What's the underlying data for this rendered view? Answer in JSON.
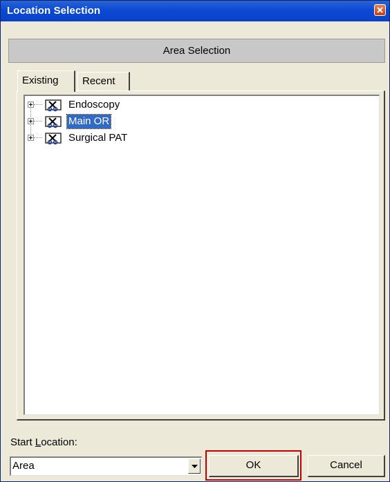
{
  "window": {
    "title": "Location Selection"
  },
  "header": {
    "area_selection": "Area Selection"
  },
  "tabs": [
    {
      "label": "Existing",
      "active": true
    },
    {
      "label": "Recent",
      "active": false
    }
  ],
  "tree": {
    "items": [
      {
        "label": "Endoscopy",
        "icon": "surgical-area-icon",
        "selected": false
      },
      {
        "label": "Main OR",
        "icon": "surgical-area-icon",
        "selected": true
      },
      {
        "label": "Surgical PAT",
        "icon": "surgical-area-icon",
        "selected": false
      }
    ]
  },
  "start_location": {
    "label_prefix": "Start ",
    "label_accel": "L",
    "label_suffix": "ocation:",
    "value": "Area"
  },
  "buttons": {
    "ok": "OK",
    "cancel": "Cancel"
  },
  "colors": {
    "titlebar": "#0c4ad4",
    "selection": "#316ac5",
    "highlight_box": "#c00000",
    "dialog_bg": "#ece9d8"
  }
}
